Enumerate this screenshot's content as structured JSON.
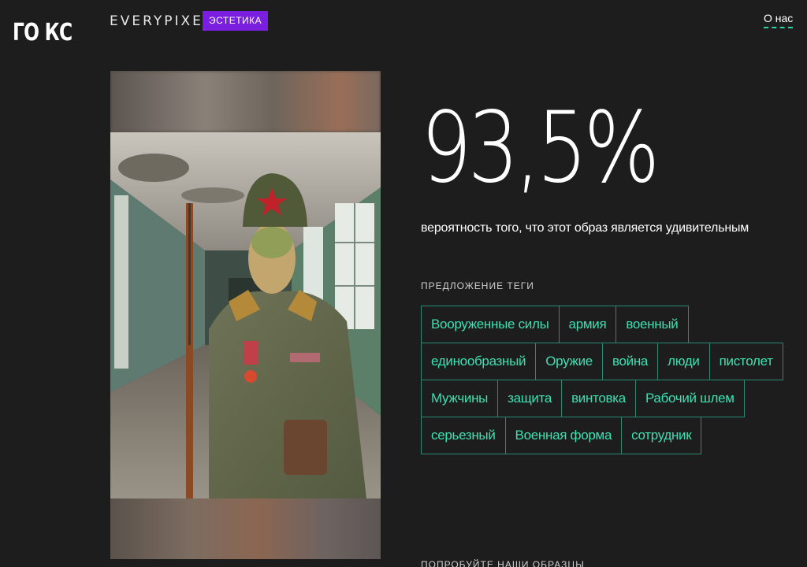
{
  "overlay": {
    "corner_text": "ГО КС"
  },
  "header": {
    "brand": "EVERYPIXEL",
    "badge": "ЭСТЕТИКА",
    "about_link": "О нас"
  },
  "result": {
    "score": "93,5%",
    "caption": "вероятность того, что этот образ является удивительным"
  },
  "tags": {
    "heading": "ПРЕДЛОЖЕНИЕ ТЕГИ",
    "items": [
      "Вооруженные силы",
      "армия",
      "военный",
      "единообразный",
      "Оружие",
      "война",
      "люди",
      "пистолет",
      "Мужчины",
      "защита",
      "винтовка",
      "Рабочий шлем",
      "серьезный",
      "Военная форма",
      "сотрудник"
    ]
  },
  "samples": {
    "heading": "ПОПРОБУЙТЕ НАШИ ОБРАЗЦЫ"
  },
  "colors": {
    "accent": "#3ee0b0",
    "badge": "#7a1fe0",
    "background": "#1d1d1d"
  }
}
